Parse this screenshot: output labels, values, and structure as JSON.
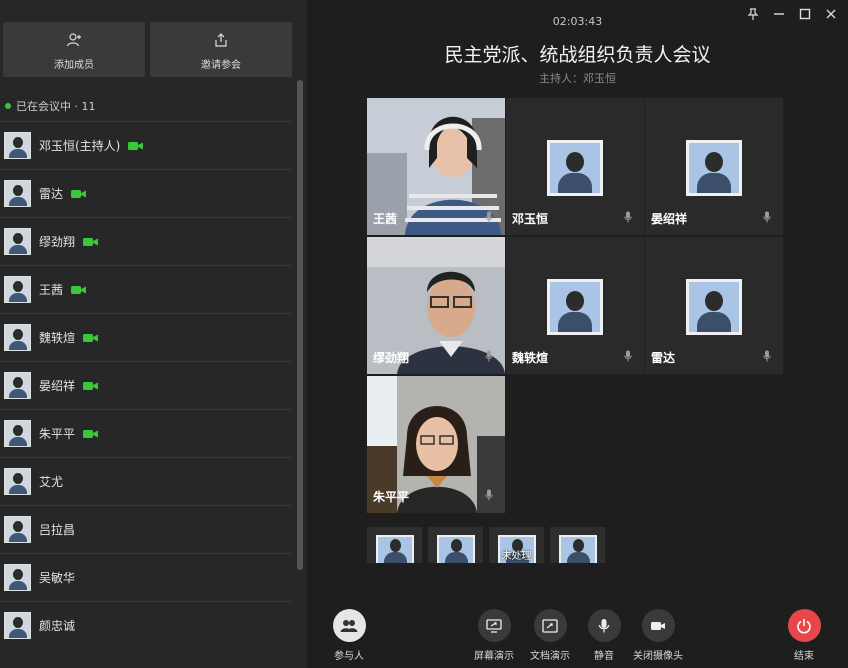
{
  "sidebar": {
    "add_member_label": "添加成员",
    "invite_label": "邀请参会",
    "status_text": "已在会议中 · 11",
    "participants": [
      {
        "name": "邓玉恒(主持人)",
        "video": true
      },
      {
        "name": "雷达",
        "video": true
      },
      {
        "name": "缪劲翔",
        "video": true
      },
      {
        "name": "王茜",
        "video": true
      },
      {
        "name": "魏轶煊",
        "video": true
      },
      {
        "name": "晏绍祥",
        "video": true
      },
      {
        "name": "朱平平",
        "video": true
      },
      {
        "name": "艾尤",
        "video": false
      },
      {
        "name": "吕拉昌",
        "video": false
      },
      {
        "name": "吴敏华",
        "video": false
      },
      {
        "name": "颜忠诚",
        "video": false
      }
    ]
  },
  "meeting": {
    "timer": "02:03:43",
    "title": "民主党派、统战组织负责人会议",
    "host": "主持人：邓玉恒"
  },
  "tiles": [
    {
      "name": "王茜",
      "kind": "video"
    },
    {
      "name": "邓玉恒",
      "kind": "photo"
    },
    {
      "name": "晏绍祥",
      "kind": "photo"
    },
    {
      "name": "缪劲翔",
      "kind": "video"
    },
    {
      "name": "魏轶煊",
      "kind": "photo"
    },
    {
      "name": "雷达",
      "kind": "photo"
    },
    {
      "name": "朱平平",
      "kind": "video"
    }
  ],
  "thumbs": [
    {
      "label": ""
    },
    {
      "label": ""
    },
    {
      "label": "未处理"
    },
    {
      "label": ""
    }
  ],
  "toolbar": {
    "participants_label": "参与人",
    "screen_share_label": "屏幕演示",
    "doc_share_label": "文档演示",
    "mute_label": "静音",
    "camera_off_label": "关闭摄像头",
    "end_label": "结束"
  },
  "colors": {
    "accent_green": "#39c839",
    "end_red": "#e8474a",
    "panel": "#272727",
    "bg": "#1e1e1e"
  }
}
